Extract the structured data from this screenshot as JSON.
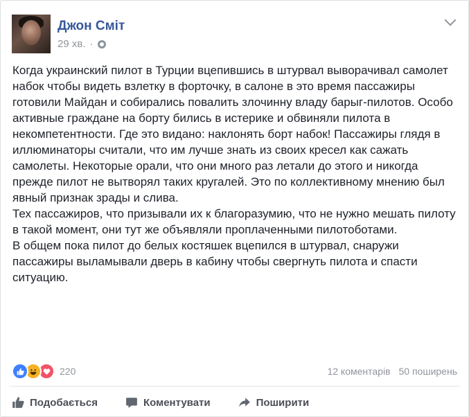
{
  "post": {
    "author": "Джон Сміт",
    "time": "29 хв.",
    "privacy_icon": "globe-icon",
    "paragraphs": [
      "Когда украинский пилот в Турции вцепившись в штурвал выворачивал самолет набок чтобы видеть взлетку в форточку, в салоне в это время пассажиры готовили Майдан и собирались повалить злочинну владу барыг-пилотов. Особо активные граждане на борту бились в истерике и обвиняли пилота в некомпетентности. Где это видано: наклонять борт набок! Пассажиры глядя в иллюминаторы считали, что им лучше знать из своих кресел как сажать самолеты. Некоторые орали, что они много раз летали до этого и никогда прежде пилот не вытворял таких кругалей. Это по коллективному мнению был явный признак зрады и слива.",
      "Тех пассажиров, что призывали их к благоразумию, что не нужно мешать пилоту в такой момент, они тут же объявляли проплаченными пилотоботами.",
      "В общем пока пилот до белых костяшек вцепился в штурвал, снаружи пассажиры выламывали дверь в кабину чтобы свергнуть пилота и спасти ситуацию."
    ]
  },
  "stats": {
    "reaction_count": "220",
    "comments": "12 коментарів",
    "shares": "50 поширень"
  },
  "actions": {
    "like": "Подобається",
    "comment": "Коментувати",
    "share": "Поширити"
  },
  "colors": {
    "link": "#365899",
    "meta": "#90949c",
    "like": "#4080ff",
    "haha": "#f7b125",
    "love": "#f25268"
  }
}
